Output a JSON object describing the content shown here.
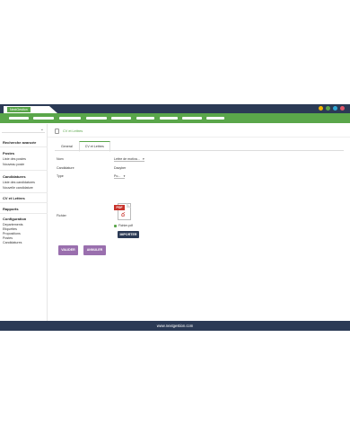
{
  "app": {
    "badge": "NextGestion",
    "window_dots": [
      "#f4b400",
      "#5aa64a",
      "#2fa8d6",
      "#e0566a"
    ]
  },
  "sidebar": {
    "groups": [
      {
        "title": "Recherche avancée",
        "items": []
      },
      {
        "title": "Postes",
        "items": [
          "Liste des postes",
          "Nouveau poste"
        ]
      },
      {
        "title": "Candidatures",
        "items": [
          "Liste des candidatures",
          "Nouvelle candidature"
        ]
      },
      {
        "title": "CV et Lettres",
        "items": []
      },
      {
        "title": "Rapports",
        "items": []
      },
      {
        "title": "Configuration",
        "items": [
          "Departements",
          "Etiquettes",
          "Propositions",
          "Postes",
          "Candidatures"
        ]
      }
    ]
  },
  "main": {
    "breadcrumb": "CV et Lettres",
    "tabs": [
      {
        "label": "General",
        "active": false
      },
      {
        "label": "CV et Lettres",
        "active": true
      }
    ],
    "form": {
      "nom_label": "Nom",
      "nom_value": "Lettre de motiva...",
      "candidature_label": "Candidature",
      "candidature_value": "Dacyber",
      "type_label": "Type",
      "type_value": "Po...",
      "fichier_label": "Fichier",
      "pdf_badge": "PDF",
      "file_name": "Fichier.pdf"
    },
    "buttons": {
      "import": "IMPORTER",
      "save": "VALIDER",
      "cancel": "ANNULER"
    }
  },
  "footer": {
    "text": "www.nextgestion.com"
  }
}
